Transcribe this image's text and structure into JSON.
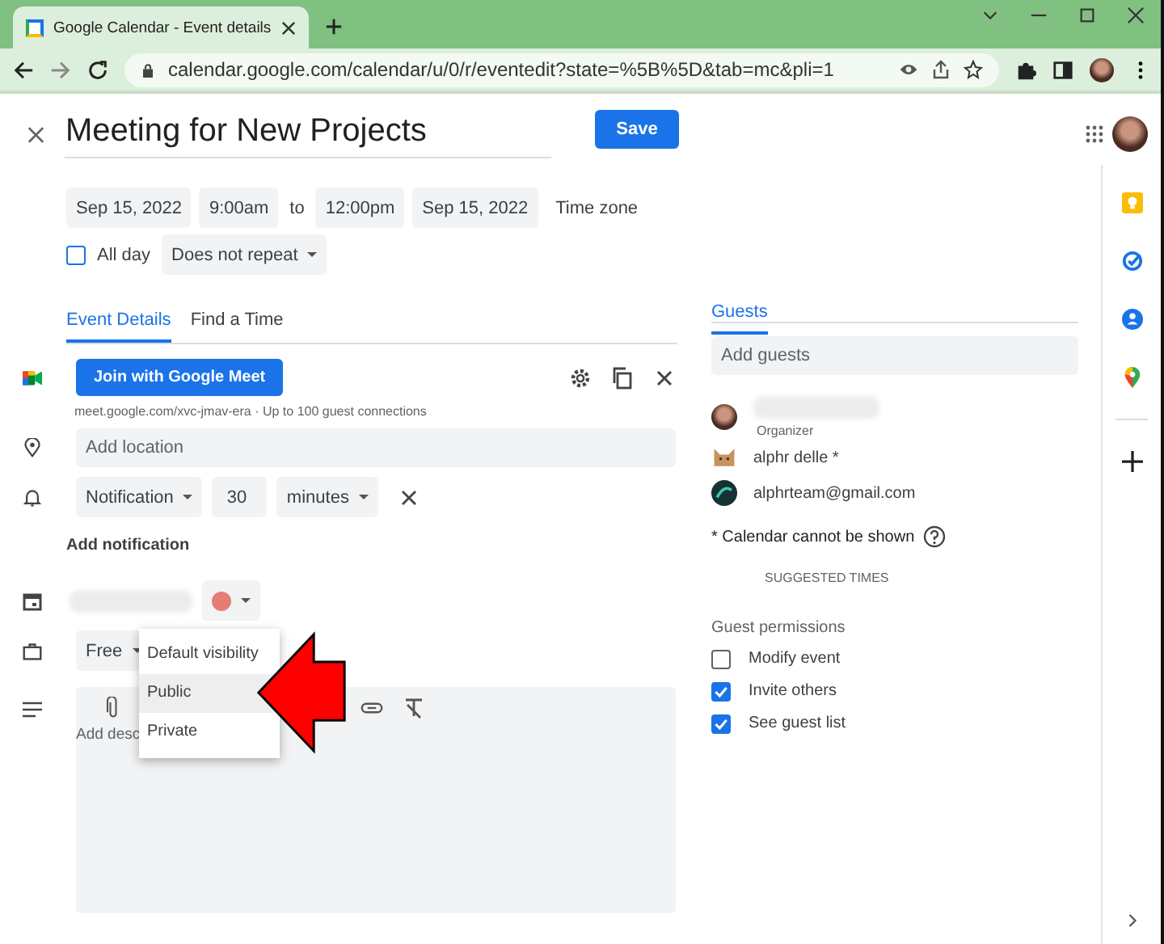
{
  "browser": {
    "tab_title": "Google Calendar - Event details",
    "url": "calendar.google.com/calendar/u/0/r/eventedit?state=%5B%5D&tab=mc&pli=1"
  },
  "event": {
    "title": "Meeting for New Projects",
    "save": "Save",
    "start_date": "Sep 15, 2022",
    "start_time": "9:00am",
    "to": "to",
    "end_time": "12:00pm",
    "end_date": "Sep 15, 2022",
    "timezone": "Time zone",
    "all_day": {
      "label": "All day",
      "checked": false
    },
    "repeat": "Does not repeat"
  },
  "tabs": [
    {
      "label": "Event Details",
      "selected": true
    },
    {
      "label": "Find a Time",
      "selected": false
    }
  ],
  "meet": {
    "button": "Join with Google Meet",
    "info": "meet.google.com/xvc-jmav-era · Up to 100 guest connections"
  },
  "location_placeholder": "Add location",
  "notification": {
    "type": "Notification",
    "value": "30",
    "unit": "minutes"
  },
  "add_notification": "Add notification",
  "availability": "Free",
  "visibility_menu": [
    {
      "label": "Default visibility",
      "selected": false
    },
    {
      "label": "Public",
      "selected": true
    },
    {
      "label": "Private",
      "selected": false
    }
  ],
  "description_placeholder": "Add desc",
  "guests": {
    "tab": "Guests",
    "placeholder": "Add guests",
    "organizer_label": "Organizer",
    "people": [
      {
        "name": "alphr delle *",
        "kind": "cat"
      },
      {
        "name": "alphrteam@gmail.com",
        "kind": "team"
      }
    ],
    "note": "* Calendar cannot be shown",
    "suggested": "SUGGESTED TIMES",
    "permissions_title": "Guest permissions",
    "permissions": [
      {
        "label": "Modify event",
        "checked": false
      },
      {
        "label": "Invite others",
        "checked": true
      },
      {
        "label": "See guest list",
        "checked": true
      }
    ]
  }
}
